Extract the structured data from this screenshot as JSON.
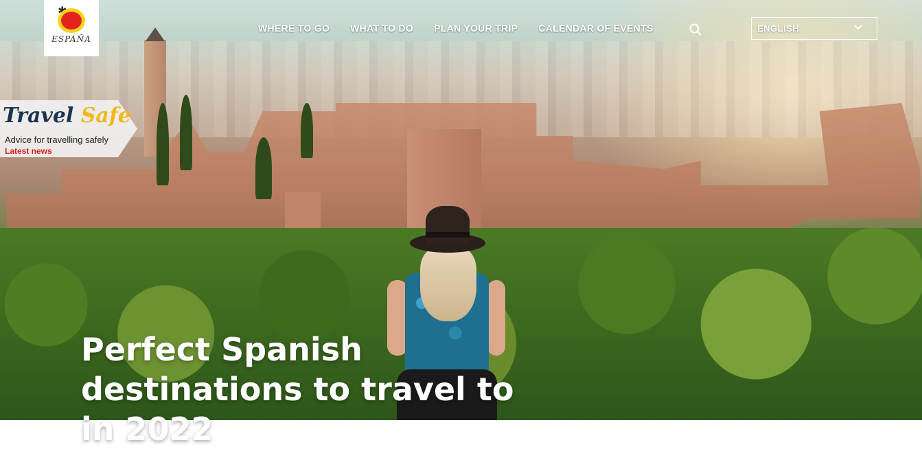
{
  "header": {
    "logo_text": "ESPAÑA",
    "nav": [
      "WHERE TO GO",
      "WHAT TO DO",
      "PLAN YOUR TRIP",
      "CALENDAR OF EVENTS"
    ],
    "language": "ENGLISH",
    "icons": [
      "search-icon",
      "chevron-down-icon"
    ]
  },
  "promo": {
    "title_part1": "Travel",
    "title_part2": "Safe",
    "subtitle": "Advice for travelling safely",
    "link": "Latest news",
    "colors": {
      "title": "#1b3551",
      "accent": "#f0b81b",
      "link": "#d3241c"
    }
  },
  "hero": {
    "headline_line1": "Perfect Spanish",
    "headline_line2": "destinations to travel to",
    "headline_line3": "in 2022"
  }
}
